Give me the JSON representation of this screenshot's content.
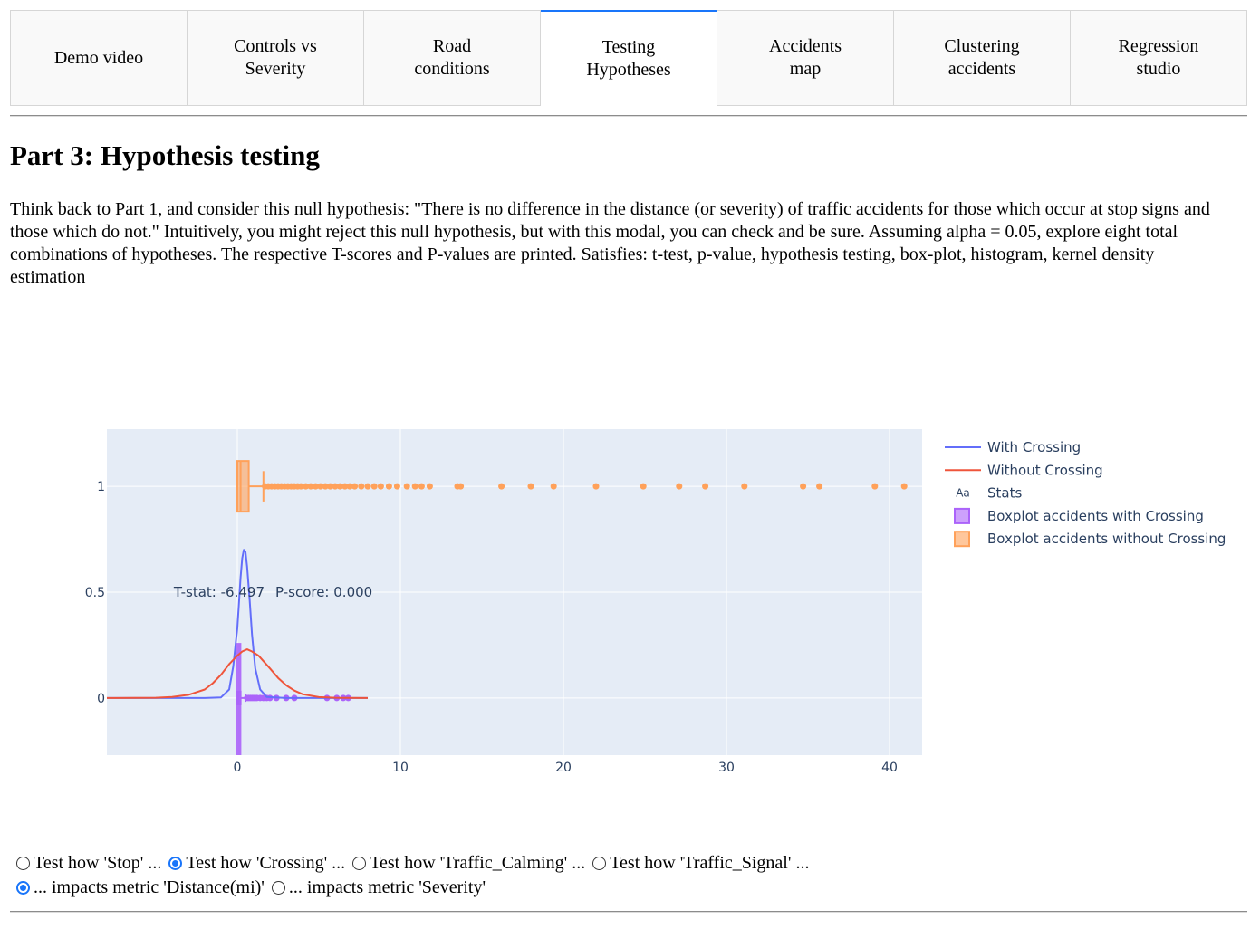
{
  "tabs": [
    {
      "label": "Demo video",
      "active": false
    },
    {
      "label": "Controls vs\nSeverity",
      "active": false
    },
    {
      "label": "Road\nconditions",
      "active": false
    },
    {
      "label": "Testing\nHypotheses",
      "active": true
    },
    {
      "label": "Accidents\nmap",
      "active": false
    },
    {
      "label": "Clustering\naccidents",
      "active": false
    },
    {
      "label": "Regression\nstudio",
      "active": false
    }
  ],
  "page": {
    "title": "Part 3: Hypothesis testing",
    "intro": "Think back to Part 1, and consider this null hypothesis: \"There is no difference in the distance (or severity) of traffic accidents for those which occur at stop signs and those which do not.\" Intuitively, you might reject this null hypothesis, but with this modal, you can check and be sure. Assuming alpha = 0.05, explore eight total combinations of hypotheses. The respective T-scores and P-values are printed. Satisfies: t-test, p-value, hypothesis testing, box-plot, histogram, kernel density estimation"
  },
  "chart_data": {
    "type": "line",
    "xlim": [
      -8,
      42
    ],
    "ylim": [
      -0.27,
      1.27
    ],
    "x_ticks": [
      0,
      10,
      20,
      30,
      40
    ],
    "y_ticks": [
      0,
      0.5,
      1
    ],
    "y_tick_labels": [
      "0",
      "0.5",
      "1"
    ],
    "grid": true,
    "legend_position": "right",
    "colors": {
      "with": "#636efa",
      "without": "#ef553b",
      "box_with": "#ab63fa",
      "box_without": "#ffa15a",
      "plot_bg": "#e5ecf6"
    },
    "series": [
      {
        "name": "With Crossing",
        "x": [
          -8,
          -2,
          -1,
          -0.5,
          -0.25,
          0,
          0.1,
          0.2,
          0.3,
          0.4,
          0.5,
          0.6,
          0.75,
          0.9,
          1.1,
          1.4,
          1.8,
          3,
          8
        ],
        "y": [
          0,
          0,
          0.003,
          0.04,
          0.15,
          0.33,
          0.45,
          0.57,
          0.66,
          0.7,
          0.69,
          0.62,
          0.47,
          0.3,
          0.14,
          0.04,
          0.005,
          0,
          0
        ]
      },
      {
        "name": "Without Crossing",
        "x": [
          -8,
          -5,
          -4,
          -3,
          -2,
          -1.5,
          -1,
          -0.5,
          0,
          0.3,
          0.6,
          0.9,
          1.3,
          2,
          2.5,
          3,
          3.5,
          4,
          5,
          6,
          8
        ],
        "y": [
          0,
          0.001,
          0.005,
          0.015,
          0.04,
          0.07,
          0.11,
          0.16,
          0.2,
          0.22,
          0.23,
          0.22,
          0.2,
          0.14,
          0.095,
          0.06,
          0.035,
          0.018,
          0.004,
          0.001,
          0
        ]
      }
    ],
    "stats": {
      "name": "Stats",
      "t_stat_label": "T-stat: -6.497",
      "p_score_label": "P-score: 0.000",
      "x": 2,
      "y": 0.5
    },
    "boxplots": [
      {
        "name": "Boxplot accidents with Crossing",
        "y": 0,
        "q1": 0.01,
        "median": 0.05,
        "q3": 0.2,
        "whisker_low": 0,
        "whisker_high": 0.5,
        "outliers": [
          0.6,
          0.7,
          0.8,
          0.9,
          1.0,
          1.1,
          1.2,
          1.4,
          1.6,
          1.8,
          2.0,
          2.4,
          3.0,
          3.5,
          5.5,
          6.1,
          6.5,
          6.8
        ]
      },
      {
        "name": "Boxplot  accidents without Crossing",
        "y": 1,
        "q1": 0,
        "median": 0.2,
        "q3": 0.7,
        "whisker_low": 0,
        "whisker_high": 1.6,
        "outliers": [
          1.7,
          1.9,
          2.1,
          2.3,
          2.5,
          2.7,
          2.9,
          3.1,
          3.3,
          3.5,
          3.7,
          3.9,
          4.2,
          4.5,
          4.8,
          5.1,
          5.4,
          5.7,
          6.0,
          6.3,
          6.6,
          6.9,
          7.2,
          7.6,
          8.0,
          8.4,
          8.8,
          9.3,
          9.8,
          10.4,
          10.9,
          11.3,
          11.8,
          13.5,
          13.7,
          16.2,
          18.0,
          19.4,
          22.0,
          24.9,
          27.1,
          28.7,
          31.1,
          34.7,
          35.7,
          39.1,
          40.9
        ]
      }
    ],
    "rug": {
      "x_min": 0,
      "x_max": 0.3,
      "y_low": -0.27,
      "y_high": 0.26
    }
  },
  "controls": {
    "group1": [
      {
        "label": "Test how 'Stop' ...",
        "checked": false
      },
      {
        "label": "Test how 'Crossing' ...",
        "checked": true
      },
      {
        "label": "Test how 'Traffic_Calming' ...",
        "checked": false
      },
      {
        "label": "Test how 'Traffic_Signal' ...",
        "checked": false
      }
    ],
    "group2": [
      {
        "label": "... impacts metric 'Distance(mi)'",
        "checked": true
      },
      {
        "label": "... impacts metric 'Severity'",
        "checked": false
      }
    ]
  }
}
